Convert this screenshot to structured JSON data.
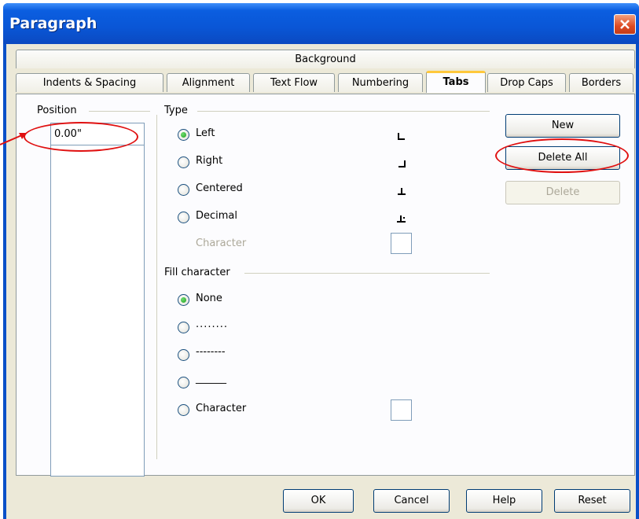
{
  "window": {
    "title": "Paragraph"
  },
  "tabs": {
    "top_row": [
      "Background"
    ],
    "bottom_row": [
      "Indents & Spacing",
      "Alignment",
      "Text Flow",
      "Numbering",
      "Tabs",
      "Drop Caps",
      "Borders"
    ],
    "active": "Tabs"
  },
  "position": {
    "label": "Position",
    "value": "0.00\""
  },
  "type": {
    "label": "Type",
    "options": [
      {
        "label": "Left",
        "checked": true,
        "glyph": "left-tab-icon"
      },
      {
        "label": "Right",
        "checked": false,
        "glyph": "right-tab-icon"
      },
      {
        "label": "Centered",
        "checked": false,
        "glyph": "center-tab-icon"
      },
      {
        "label": "Decimal",
        "checked": false,
        "glyph": "decimal-tab-icon"
      }
    ],
    "character_label": "Character"
  },
  "fill": {
    "label": "Fill character",
    "options": [
      {
        "label": "None",
        "checked": true
      },
      {
        "label": "........",
        "checked": false
      },
      {
        "label": "--------",
        "checked": false
      },
      {
        "label": "______",
        "checked": false
      },
      {
        "label": "Character",
        "checked": false
      }
    ]
  },
  "side_buttons": {
    "new": "New",
    "delete_all": "Delete All",
    "delete": "Delete"
  },
  "footer": {
    "ok": "OK",
    "cancel": "Cancel",
    "help": "Help",
    "reset": "Reset"
  },
  "colors": {
    "titlebar": "#0a56d6",
    "dialog_bg": "#ece9d8",
    "annotation": "#e01010",
    "radio_selected": "#21a121"
  }
}
